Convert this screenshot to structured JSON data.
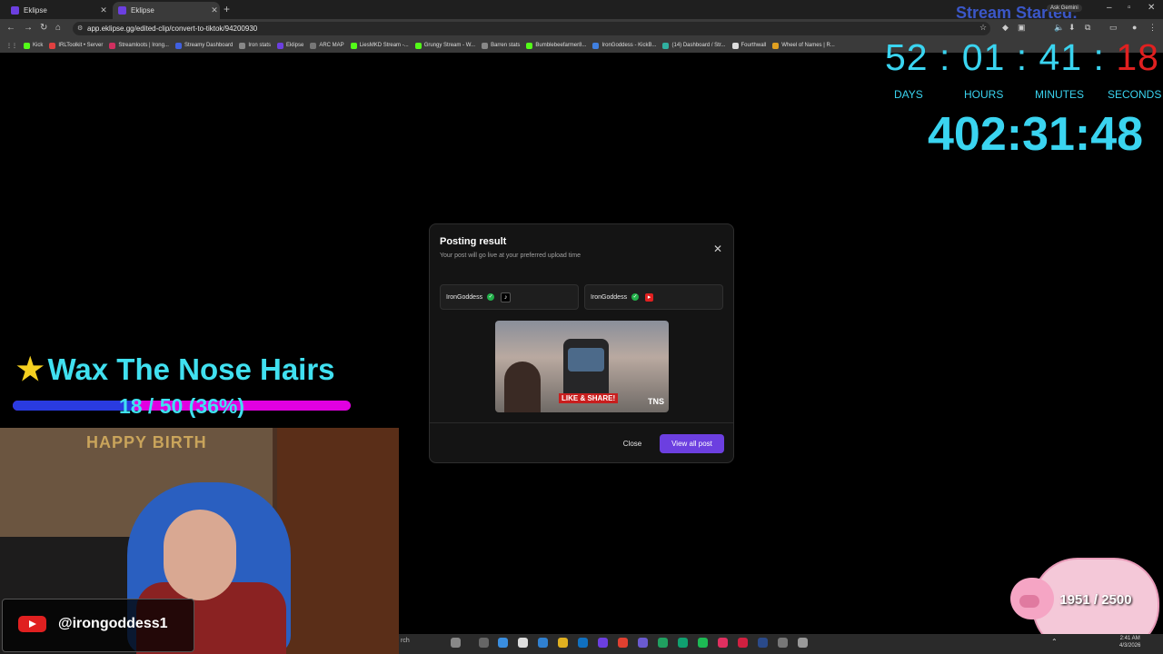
{
  "browser": {
    "tabs": [
      {
        "title": "Eklipse",
        "favicon_color": "#6c3fe0"
      },
      {
        "title": "Eklipse",
        "favicon_color": "#6c3fe0"
      }
    ],
    "url": "app.eklipse.gg/edited-clip/convert-to-tiktok/94200930",
    "ask_gemini": "Ask Gemini",
    "bookmarks": [
      {
        "label": "Kick",
        "color": "#53fc18"
      },
      {
        "label": "IRLToolkit • Server",
        "color": "#e04040"
      },
      {
        "label": "Streamloots | Irong...",
        "color": "#d03060"
      },
      {
        "label": "Streamy Dashboard",
        "color": "#4060e0"
      },
      {
        "label": "Iron stats",
        "color": "#888888"
      },
      {
        "label": "Eklipse",
        "color": "#6c3fe0"
      },
      {
        "label": "ARC MAP",
        "color": "#777777"
      },
      {
        "label": "LiesMKD Stream -...",
        "color": "#53fc18"
      },
      {
        "label": "Grungy Stream - W...",
        "color": "#53fc18"
      },
      {
        "label": "Barren stats",
        "color": "#888888"
      },
      {
        "label": "Bumblebeefarmer8...",
        "color": "#53fc18"
      },
      {
        "label": "IronGoddess - KickB...",
        "color": "#4080e0"
      },
      {
        "label": "(14) Dashboard / Str...",
        "color": "#30b0a0"
      },
      {
        "label": "Fourthwall",
        "color": "#dddddd"
      },
      {
        "label": "Wheel of Names | R...",
        "color": "#e0a020"
      }
    ]
  },
  "overlay": {
    "stream_started": "Stream Started:",
    "countdown_main": "52 : 01 : 41 : ",
    "countdown_seconds": "18",
    "labels": {
      "days": "DAYS",
      "hours": "HOURS",
      "minutes": "MINUTES",
      "seconds": "SECONDS"
    },
    "uptime": "402:31:48",
    "goal": {
      "title": "Wax The Nose Hairs",
      "progress_text": "18 / 50 (36%)",
      "progress": 0.36
    },
    "youtube_handle": "@irongoddess1",
    "piggy": "1951 / 2500",
    "webcam_banner": "HAPPY BIRTH"
  },
  "modal": {
    "title": "Posting result",
    "subtitle": "Your post will go live at your preferred upload time",
    "accounts": [
      {
        "name": "IronGoddess",
        "platform": "tiktok",
        "status": "success"
      },
      {
        "name": "IronGoddess",
        "platform": "youtube",
        "status": "success"
      }
    ],
    "thumbnail_caption": "LIKE & SHARE!",
    "thumbnail_logo": "TNS",
    "close_label": "Close",
    "view_all_label": "View all post"
  },
  "taskbar": {
    "search_text": "rch",
    "clock_time": "2:41 AM",
    "clock_date": "4/3/2026"
  }
}
